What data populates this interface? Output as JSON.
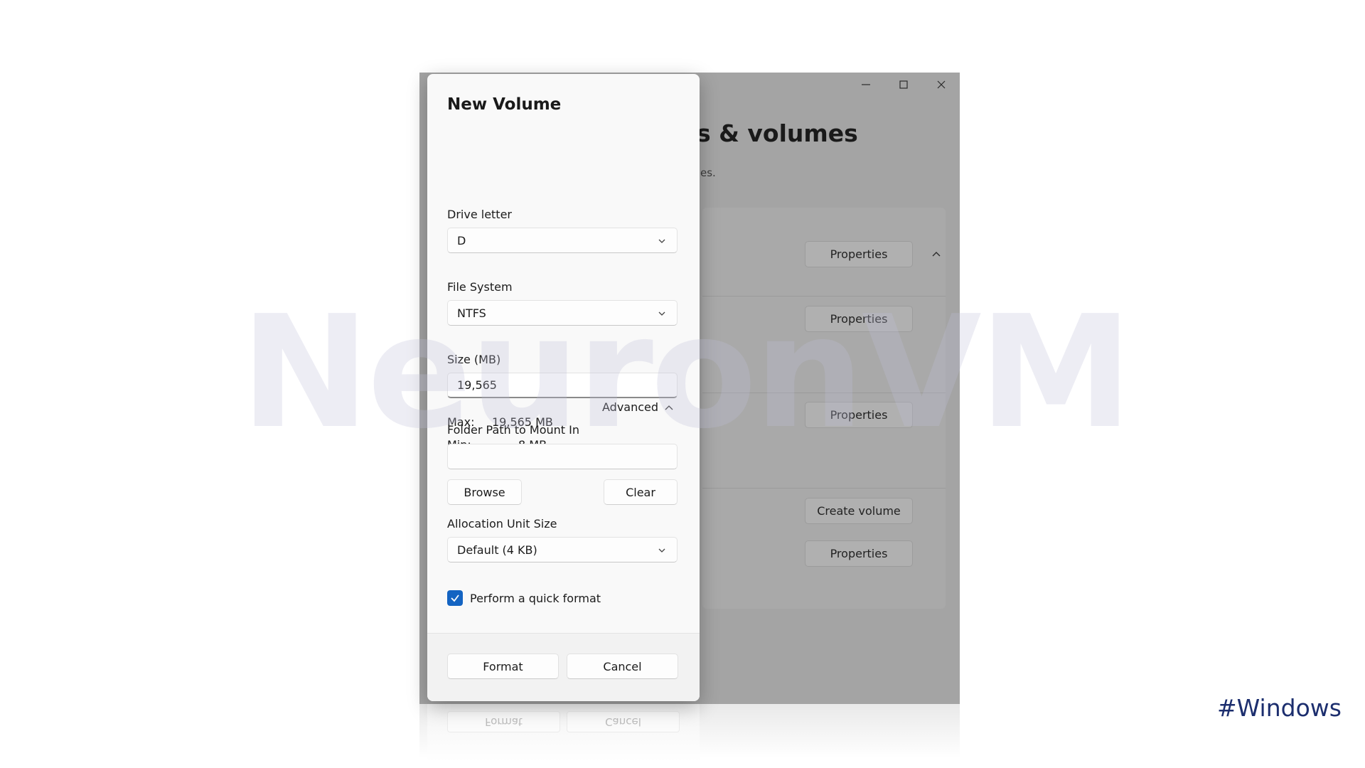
{
  "background_window": {
    "heading": "s & volumes",
    "subtitle": "es.",
    "buttons": [
      "Properties",
      "Properties",
      "Properties",
      "Create volume",
      "Properties"
    ]
  },
  "dialog": {
    "title": "New Volume",
    "drive_letter": {
      "label": "Drive letter",
      "value": "D"
    },
    "file_system": {
      "label": "File System",
      "value": "NTFS"
    },
    "size": {
      "label": "Size (MB)",
      "value": "19,565"
    },
    "max": {
      "label": "Max:",
      "value": "19,565 MB"
    },
    "min": {
      "label": "Min:",
      "value": "8 MB"
    },
    "advanced_label": "Advanced",
    "mount_path": {
      "label": "Folder Path to Mount In",
      "value": ""
    },
    "browse_label": "Browse",
    "clear_label": "Clear",
    "allocation": {
      "label": "Allocation Unit Size",
      "value": "Default (4 KB)"
    },
    "quick_format": {
      "label": "Perform a quick format",
      "checked": true
    },
    "format_label": "Format",
    "cancel_label": "Cancel"
  },
  "watermark": "NeuronVM",
  "hashtag": "#Windows",
  "colors": {
    "accent": "#1464c2",
    "hashtag": "#1c2e6e"
  }
}
